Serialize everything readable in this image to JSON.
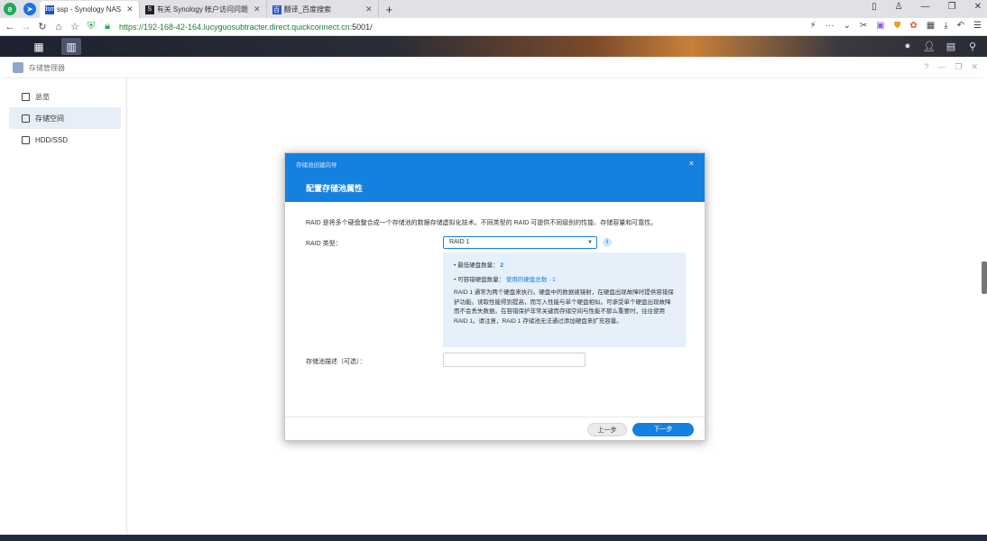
{
  "browser": {
    "tabs": [
      {
        "label": "ssp - Synology NAS",
        "favicon": "syno-icon",
        "color": "#1a55c8"
      },
      {
        "label": "有关 Synology 帐户访问问题",
        "favicon": "s-icon",
        "color": "#222222"
      },
      {
        "label": "翻译_百度搜索",
        "favicon": "baidu-icon",
        "color": "#2c55d8"
      }
    ],
    "url_host": "https://192-168-42-164.lucyguosubtracter.direct.quickconnect.cn",
    "url_rest": ":5001/"
  },
  "app": {
    "title": "存储管理器"
  },
  "sidebar": {
    "items": [
      {
        "label": "总览"
      },
      {
        "label": "存储空间"
      },
      {
        "label": "HDD/SSD"
      }
    ]
  },
  "wizard": {
    "header_small": "存储池创建向导",
    "title": "配置存储池属性",
    "close": "×",
    "description": "RAID 是将多个硬盘整合成一个存储池的数据存储虚拟化技术。不同类型的 RAID 可提供不同级别的性能、存储容量和可靠性。",
    "raid_label": "RAID 类型：",
    "raid_value": "RAID 1",
    "info": {
      "min_disks_label": "最低硬盘数量：",
      "min_disks_value": "2",
      "tolerance_label": "可容错硬盘数量：",
      "tolerance_value": "使用的硬盘总数 - 1",
      "paragraph": "RAID 1 通常为两个硬盘来执行。硬盘中的数据被镜射，在硬盘出现故障时提供容错保护功能。读取性能得到提高，而写入性能与单个硬盘相似。可承受单个硬盘出现故障而不会丢失数据。在容错保护非常关键而存储空间与性能不那么重要时，往往使用 RAID 1。请注意，RAID 1 存储池无法通过添加硬盘来扩充容量。"
    },
    "desc_label": "存储池描述（可选）：",
    "desc_placeholder": "",
    "btn_prev": "上一步",
    "btn_next": "下一步"
  },
  "colors": {
    "accent": "#1480df",
    "info_bg": "#e5f0fb"
  }
}
